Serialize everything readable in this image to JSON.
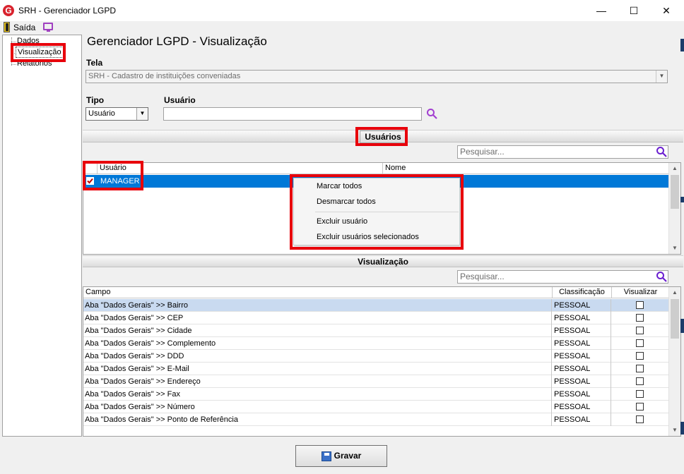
{
  "window": {
    "title": "SRH - Gerenciador LGPD",
    "logo_letter": "G",
    "minimize_glyph": "—",
    "maximize_glyph": "☐",
    "close_glyph": "✕"
  },
  "menu": {
    "exit_label": "Saída",
    "exit_icon": "door-exit-icon",
    "monitor_icon": "monitor-icon"
  },
  "tree": {
    "items": [
      {
        "label": "Dados"
      },
      {
        "label": "Visualização"
      },
      {
        "label": "Relatórios"
      }
    ],
    "selected_index": 1
  },
  "main": {
    "title": "Gerenciador LGPD - Visualização",
    "tela_label": "Tela",
    "tela_value": "SRH - Cadastro de instituições conveniadas",
    "tipo_label": "Tipo",
    "tipo_value": "Usuário",
    "usuario_label": "Usuário",
    "usuario_value": ""
  },
  "users_section": {
    "title": "Usuários",
    "search_placeholder": "Pesquisar...",
    "columns": [
      "Usuário",
      "Nome"
    ],
    "rows": [
      {
        "usuario": "MANAGER",
        "nome": "",
        "checked": true
      }
    ]
  },
  "context_menu": {
    "items": [
      "Marcar todos",
      "Desmarcar todos",
      "Excluir usuário",
      "Excluir usuários selecionados"
    ]
  },
  "view_section": {
    "title": "Visualização",
    "search_placeholder": "Pesquisar...",
    "columns": [
      "Campo",
      "Classificação",
      "Visualizar"
    ],
    "rows": [
      {
        "campo": "Aba \"Dados Gerais\" >> Bairro",
        "classificacao": "PESSOAL",
        "visualizar": false
      },
      {
        "campo": "Aba \"Dados Gerais\" >> CEP",
        "classificacao": "PESSOAL",
        "visualizar": false
      },
      {
        "campo": "Aba \"Dados Gerais\" >> Cidade",
        "classificacao": "PESSOAL",
        "visualizar": false
      },
      {
        "campo": "Aba \"Dados Gerais\" >> Complemento",
        "classificacao": "PESSOAL",
        "visualizar": false
      },
      {
        "campo": "Aba \"Dados Gerais\" >> DDD",
        "classificacao": "PESSOAL",
        "visualizar": false
      },
      {
        "campo": "Aba \"Dados Gerais\" >> E-Mail",
        "classificacao": "PESSOAL",
        "visualizar": false
      },
      {
        "campo": "Aba \"Dados Gerais\" >> Endereço",
        "classificacao": "PESSOAL",
        "visualizar": false
      },
      {
        "campo": "Aba \"Dados Gerais\" >> Fax",
        "classificacao": "PESSOAL",
        "visualizar": false
      },
      {
        "campo": "Aba \"Dados Gerais\" >> Número",
        "classificacao": "PESSOAL",
        "visualizar": false
      },
      {
        "campo": "Aba \"Dados Gerais\" >> Ponto de Referência",
        "classificacao": "PESSOAL",
        "visualizar": false
      }
    ],
    "selected_index": 0
  },
  "footer": {
    "save_label": "Gravar",
    "save_icon": "floppy-disk-icon"
  },
  "colors": {
    "highlight": "#e8000b",
    "selection": "#0078d7",
    "selected_row": "#c9daf0"
  }
}
